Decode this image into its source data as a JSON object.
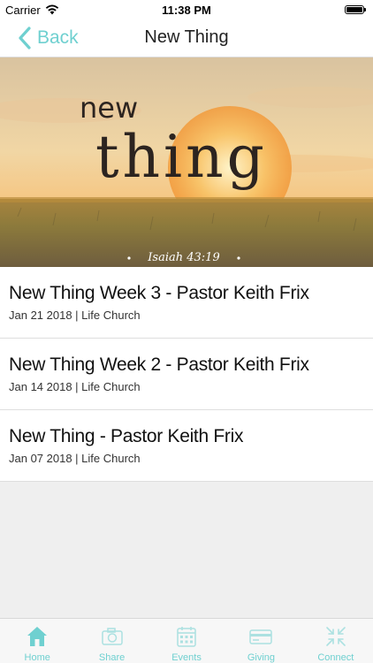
{
  "status_bar": {
    "carrier": "Carrier",
    "time": "11:38 PM"
  },
  "nav": {
    "back_label": "Back",
    "title": "New Thing"
  },
  "hero": {
    "line1": "new",
    "line2": "thing",
    "verse": "Isaiah 43:19"
  },
  "sermons": [
    {
      "title": "New Thing Week 3 - Pastor Keith Frix",
      "subtitle": "Jan 21 2018 | Life Church"
    },
    {
      "title": "New Thing Week 2 - Pastor Keith Frix",
      "subtitle": "Jan 14 2018 | Life Church"
    },
    {
      "title": "New Thing - Pastor Keith Frix",
      "subtitle": "Jan 07 2018 | Life Church"
    }
  ],
  "tabs": [
    {
      "label": "Home",
      "icon": "home-icon"
    },
    {
      "label": "Share",
      "icon": "camera-icon"
    },
    {
      "label": "Events",
      "icon": "calendar-icon"
    },
    {
      "label": "Giving",
      "icon": "credit-card-icon"
    },
    {
      "label": "Connect",
      "icon": "connect-arrows-icon"
    }
  ],
  "colors": {
    "accent": "#6fd0d0",
    "background": "#efefef"
  }
}
